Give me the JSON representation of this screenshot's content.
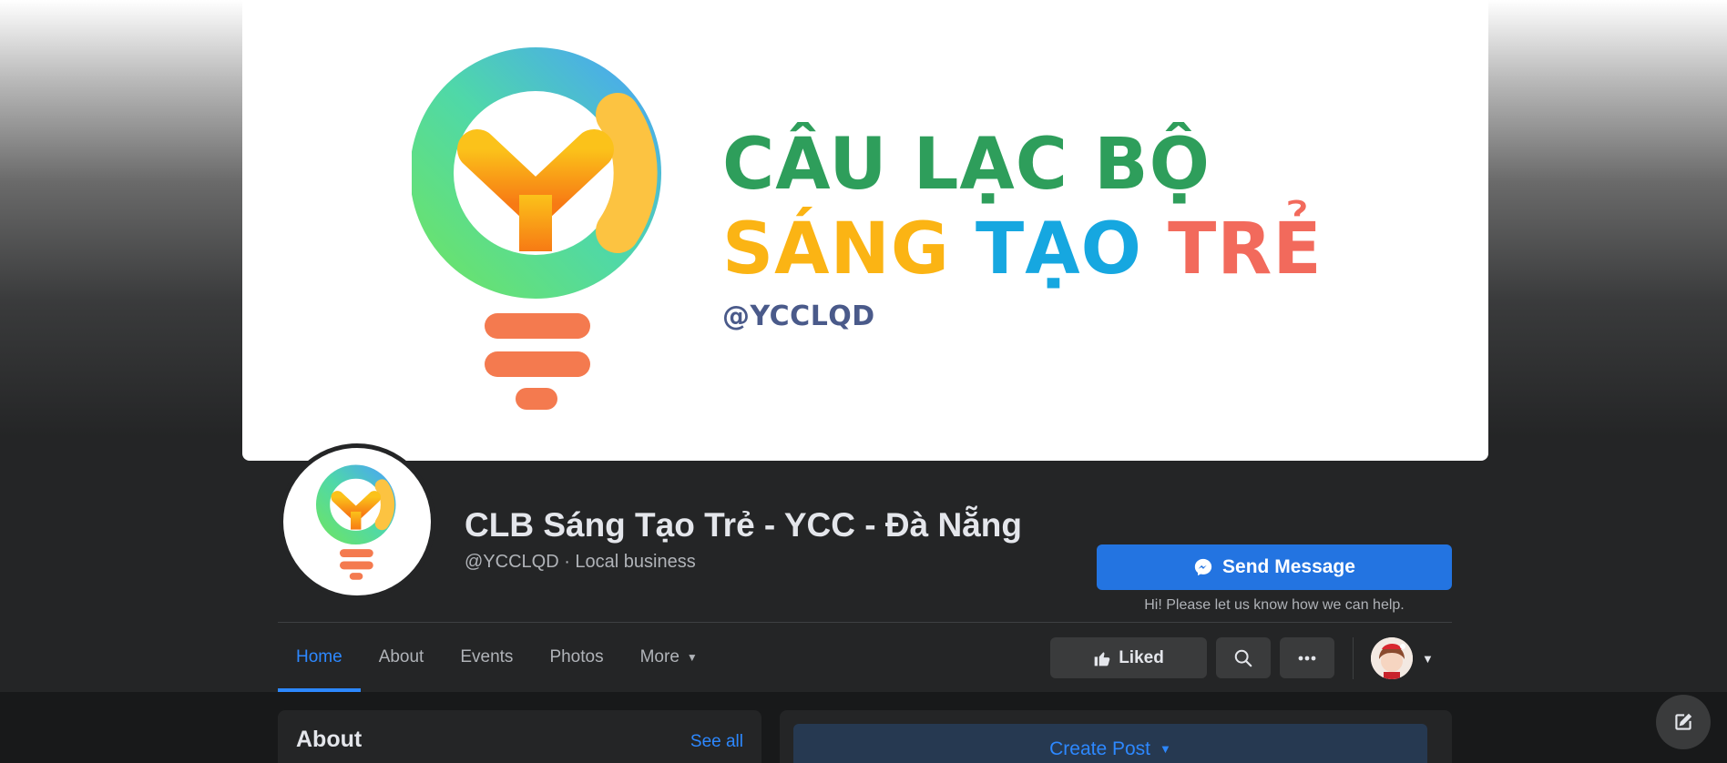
{
  "cover": {
    "line1": "CÂU LẠC BỘ",
    "line2_part1": "SÁNG",
    "line2_part2": "TẠO",
    "line2_part3": "TRẺ",
    "handle": "@YCCLQD"
  },
  "page": {
    "name": "CLB Sáng Tạo Trẻ - YCC - Đà Nẵng",
    "subtitle": "@YCCLQD · Local business"
  },
  "cta": {
    "send_label": "Send Message",
    "hint": "Hi! Please let us know how we can help."
  },
  "nav": {
    "tabs": [
      {
        "label": "Home"
      },
      {
        "label": "About"
      },
      {
        "label": "Events"
      },
      {
        "label": "Photos"
      },
      {
        "label": "More"
      }
    ]
  },
  "actions": {
    "liked_label": "Liked"
  },
  "about": {
    "title": "About",
    "see_all": "See all"
  },
  "post": {
    "create_label": "Create Post"
  },
  "icons": {
    "messenger": "messenger-icon",
    "like": "thumbs-up-icon",
    "search": "search-icon",
    "more": "ellipsis-icon",
    "compose": "compose-icon"
  },
  "colors": {
    "accent": "#2d88ff",
    "button_primary": "#2374e1",
    "cover_green": "#2e9e5b",
    "cover_yellow": "#fbb414",
    "cover_blue": "#16a7e0",
    "cover_red": "#f26a5c"
  }
}
